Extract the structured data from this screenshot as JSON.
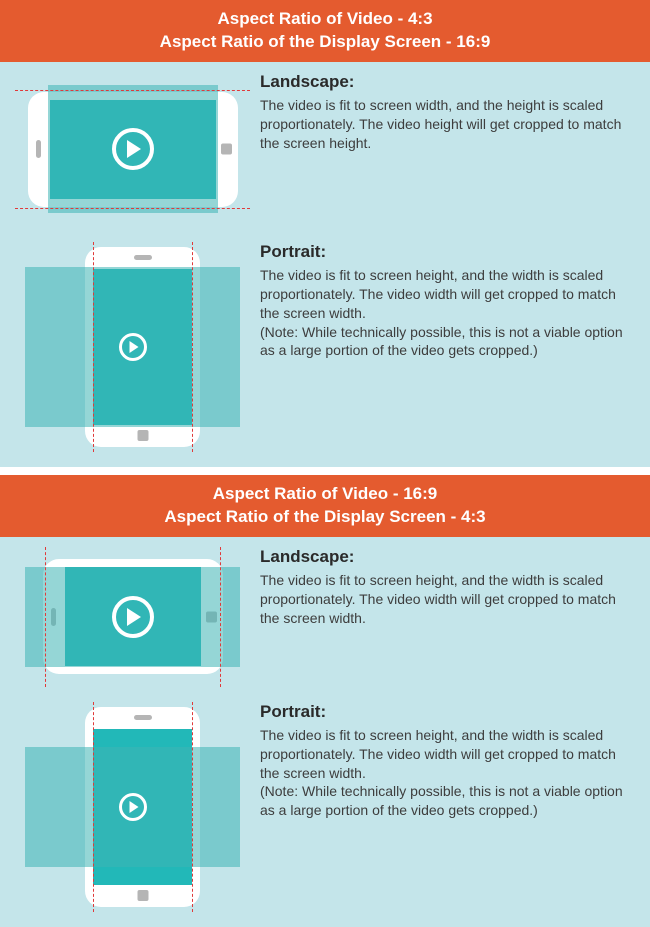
{
  "section1": {
    "header_line1": "Aspect Ratio of Video - 4:3",
    "header_line2": "Aspect Ratio of the Display Screen - 16:9",
    "landscape": {
      "title": "Landscape:",
      "body": "The video is fit to screen width, and the height is scaled proportionately. The video height will get cropped to match the screen height."
    },
    "portrait": {
      "title": "Portrait:",
      "body": "The video is fit to screen height, and the width is scaled proportionately. The video width will get cropped to match the screen width.\n(Note: While technically possible, this is not a viable option as a large portion of the video gets cropped.)"
    }
  },
  "section2": {
    "header_line1": "Aspect Ratio of Video - 16:9",
    "header_line2": "Aspect Ratio of the Display Screen - 4:3",
    "landscape": {
      "title": "Landscape:",
      "body": "The video is fit to screen height, and the width is scaled proportionately. The video width will get cropped to match the screen width."
    },
    "portrait": {
      "title": "Portrait:",
      "body": "The video is fit to screen height, and the width is scaled proportionately. The video width will get cropped to match the screen width.\n(Note: While technically possible, this is not a viable option as a large portion of the video gets cropped.)"
    }
  }
}
